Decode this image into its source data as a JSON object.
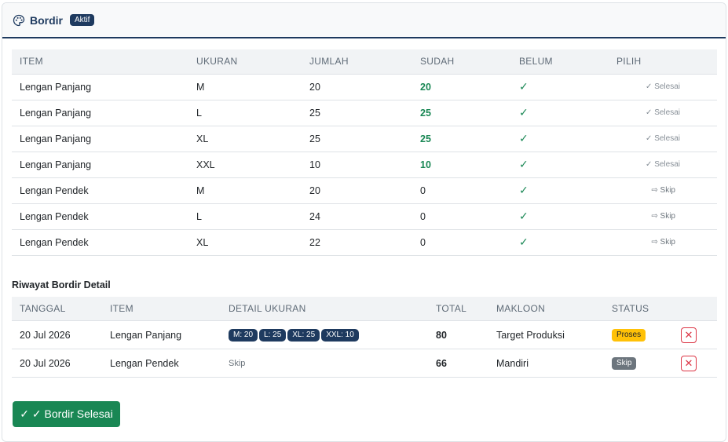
{
  "header": {
    "title": "Bordir",
    "status_badge": "Aktif"
  },
  "items_table": {
    "columns": [
      "ITEM",
      "UKURAN",
      "JUMLAH",
      "SUDAH",
      "BELUM",
      "PILIH"
    ],
    "rows": [
      {
        "item": "Lengan Panjang",
        "ukuran": "M",
        "jumlah": "20",
        "sudah": "20",
        "belum": "✓",
        "pilih": "✓ Selesai",
        "done": true
      },
      {
        "item": "Lengan Panjang",
        "ukuran": "L",
        "jumlah": "25",
        "sudah": "25",
        "belum": "✓",
        "pilih": "✓ Selesai",
        "done": true
      },
      {
        "item": "Lengan Panjang",
        "ukuran": "XL",
        "jumlah": "25",
        "sudah": "25",
        "belum": "✓",
        "pilih": "✓ Selesai",
        "done": true
      },
      {
        "item": "Lengan Panjang",
        "ukuran": "XXL",
        "jumlah": "10",
        "sudah": "10",
        "belum": "✓",
        "pilih": "✓ Selesai",
        "done": true
      },
      {
        "item": "Lengan Pendek",
        "ukuran": "M",
        "jumlah": "20",
        "sudah": "0",
        "belum": "✓",
        "pilih": "⇨ Skip",
        "done": false
      },
      {
        "item": "Lengan Pendek",
        "ukuran": "L",
        "jumlah": "24",
        "sudah": "0",
        "belum": "✓",
        "pilih": "⇨ Skip",
        "done": false
      },
      {
        "item": "Lengan Pendek",
        "ukuran": "XL",
        "jumlah": "22",
        "sudah": "0",
        "belum": "✓",
        "pilih": "⇨ Skip",
        "done": false
      }
    ]
  },
  "history": {
    "title": "Riwayat Bordir Detail",
    "columns": [
      "TANGGAL",
      "ITEM",
      "DETAIL UKURAN",
      "TOTAL",
      "MAKLOON",
      "STATUS"
    ],
    "rows": [
      {
        "tanggal": "20 Jul 2026",
        "item": "Lengan Panjang",
        "sizes": [
          "M: 20",
          "L: 25",
          "XL: 25",
          "XXL: 10"
        ],
        "detail_text": "",
        "total": "80",
        "makloon": "Target Produksi",
        "status": "Proses",
        "status_kind": "proses"
      },
      {
        "tanggal": "20 Jul 2026",
        "item": "Lengan Pendek",
        "sizes": [],
        "detail_text": "Skip",
        "total": "66",
        "makloon": "Mandiri",
        "status": "Skip",
        "status_kind": "skip"
      }
    ]
  },
  "footer": {
    "done_button_label": "✓ ✓ Bordir Selesai"
  },
  "colors": {
    "primary": "#1e3a5f",
    "success": "#198754",
    "warning": "#ffc107",
    "danger": "#dc3545",
    "muted": "#6c757d"
  },
  "icons": {
    "header": "palette-icon",
    "delete": "close-icon"
  }
}
